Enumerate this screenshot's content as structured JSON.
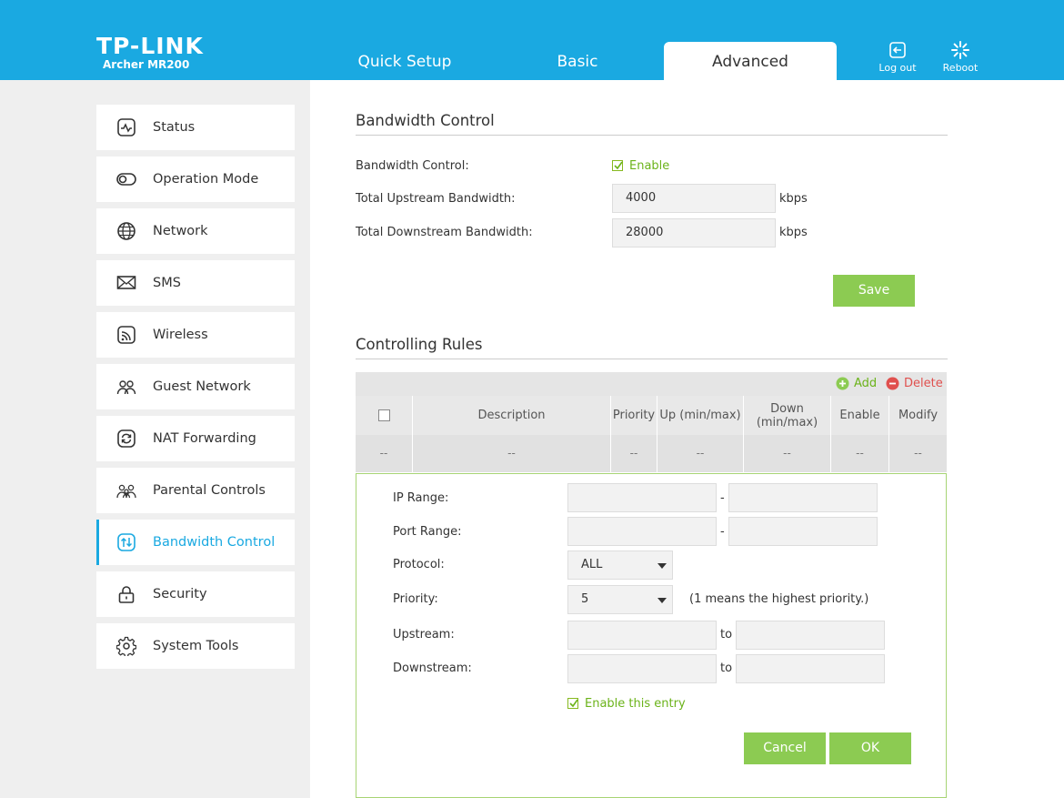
{
  "header": {
    "logo": "TP-LINK",
    "model": "Archer MR200",
    "tabs": [
      {
        "label": "Quick Setup"
      },
      {
        "label": "Basic"
      },
      {
        "label": "Advanced"
      }
    ],
    "logout_label": "Log out",
    "reboot_label": "Reboot"
  },
  "sidebar": {
    "items": [
      {
        "label": "Status",
        "icon": "status-icon"
      },
      {
        "label": "Operation Mode",
        "icon": "toggle-icon"
      },
      {
        "label": "Network",
        "icon": "globe-icon"
      },
      {
        "label": "SMS",
        "icon": "envelope-icon"
      },
      {
        "label": "Wireless",
        "icon": "wifi-icon"
      },
      {
        "label": "Guest Network",
        "icon": "guests-icon"
      },
      {
        "label": "NAT Forwarding",
        "icon": "refresh-icon"
      },
      {
        "label": "Parental Controls",
        "icon": "family-icon"
      },
      {
        "label": "Bandwidth Control",
        "icon": "updown-arrows-icon"
      },
      {
        "label": "Security",
        "icon": "lock-icon"
      },
      {
        "label": "System Tools",
        "icon": "gear-icon"
      }
    ],
    "active_index": 8
  },
  "bandwidth": {
    "title": "Bandwidth Control",
    "control_label": "Bandwidth Control:",
    "enable_label": "Enable",
    "upstream_label": "Total Upstream Bandwidth:",
    "upstream_value": "4000",
    "downstream_label": "Total Downstream Bandwidth:",
    "downstream_value": "28000",
    "unit": "kbps",
    "save_label": "Save"
  },
  "rules": {
    "title": "Controlling Rules",
    "add_label": "Add",
    "delete_label": "Delete",
    "columns": [
      "Description",
      "Priority",
      "Up (min/max)",
      "Down (min/max)",
      "Enable",
      "Modify"
    ],
    "empty_cell": "--"
  },
  "form": {
    "ip_range_label": "IP Range:",
    "port_range_label": "Port Range:",
    "protocol_label": "Protocol:",
    "protocol_value": "ALL",
    "priority_label": "Priority:",
    "priority_value": "5",
    "priority_hint": "(1 means the highest priority.)",
    "upstream_label": "Upstream:",
    "downstream_label": "Downstream:",
    "range_sep": "-",
    "to_label": "to",
    "enable_entry_label": "Enable this entry",
    "cancel_label": "Cancel",
    "ok_label": "OK"
  },
  "colors": {
    "header_blue": "#1aa9e1",
    "accent_green": "#8ccb52",
    "delete_red": "#e0504e"
  }
}
